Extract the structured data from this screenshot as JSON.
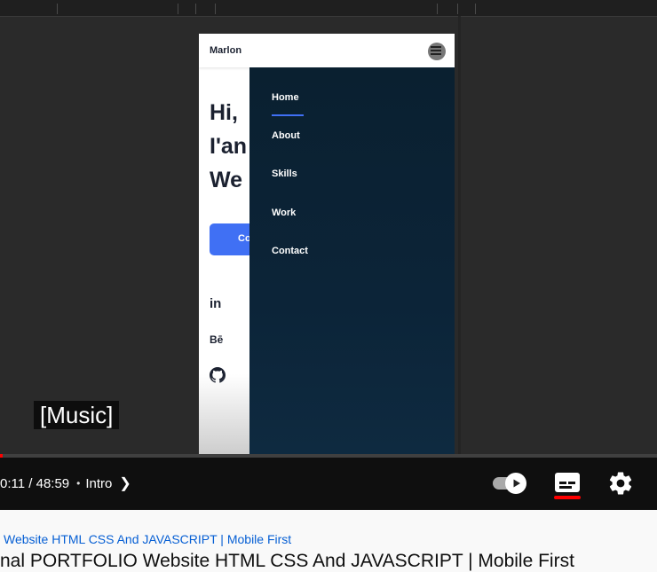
{
  "player": {
    "phone": {
      "brand": "Marlon",
      "hero_lines": [
        "Hi,",
        "I'an",
        "We"
      ],
      "cta_label": "Co",
      "social": {
        "linkedin": "in",
        "behance": "Bē"
      },
      "menu_items": [
        "Home",
        "About",
        "Skills",
        "Work",
        "Contact"
      ]
    },
    "caption": "[Music]",
    "progress_fraction": 0.0038,
    "controls": {
      "time_current": "0:11",
      "time_separator": "/",
      "time_total": "48:59",
      "chapter": "Intro"
    },
    "icons": {
      "chapter_chevron": "chevron-right-icon",
      "autoplay": "autoplay-toggle-icon",
      "captions": "subtitles-icon",
      "settings": "gear-icon",
      "github": "github-icon",
      "menu": "hamburger-icon"
    },
    "colors": {
      "progress_played": "#ff0000",
      "cta": "#4070f4",
      "menu_background": "#0c2438",
      "cc_active": "#ff0000"
    }
  },
  "below": {
    "link_text": "Website HTML CSS And JAVASCRIPT | Mobile First",
    "title_text": "nal PORTFOLIO Website HTML CSS And JAVASCRIPT | Mobile First"
  }
}
